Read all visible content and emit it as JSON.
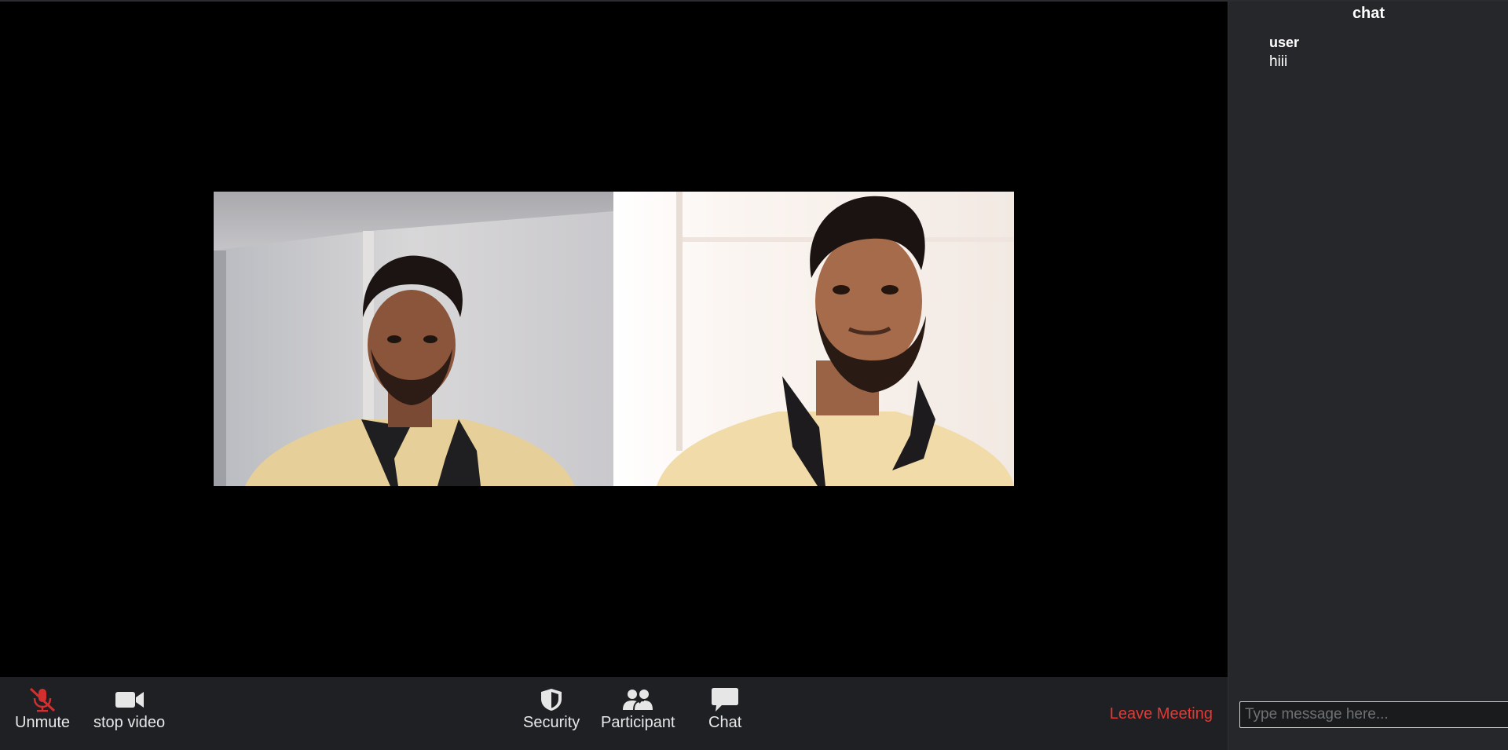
{
  "toolbar": {
    "unmute_label": "Unmute",
    "stop_video_label": "stop video",
    "security_label": "Security",
    "participant_label": "Participant",
    "chat_label": "Chat",
    "leave_label": "Leave Meeting"
  },
  "chat": {
    "title": "chat",
    "messages": [
      {
        "sender": "user",
        "text": "hiii"
      }
    ],
    "input_placeholder": "Type message here..."
  },
  "colors": {
    "toolbar_bg": "#1e2023",
    "chat_bg": "#25272a",
    "leave_red": "#e53935",
    "muted_mic_red": "#d32f2f"
  },
  "icons": {
    "unmute": "microphone-muted-icon",
    "video": "video-camera-icon",
    "security": "shield-icon",
    "participant": "people-icon",
    "chat": "chat-bubble-icon"
  }
}
